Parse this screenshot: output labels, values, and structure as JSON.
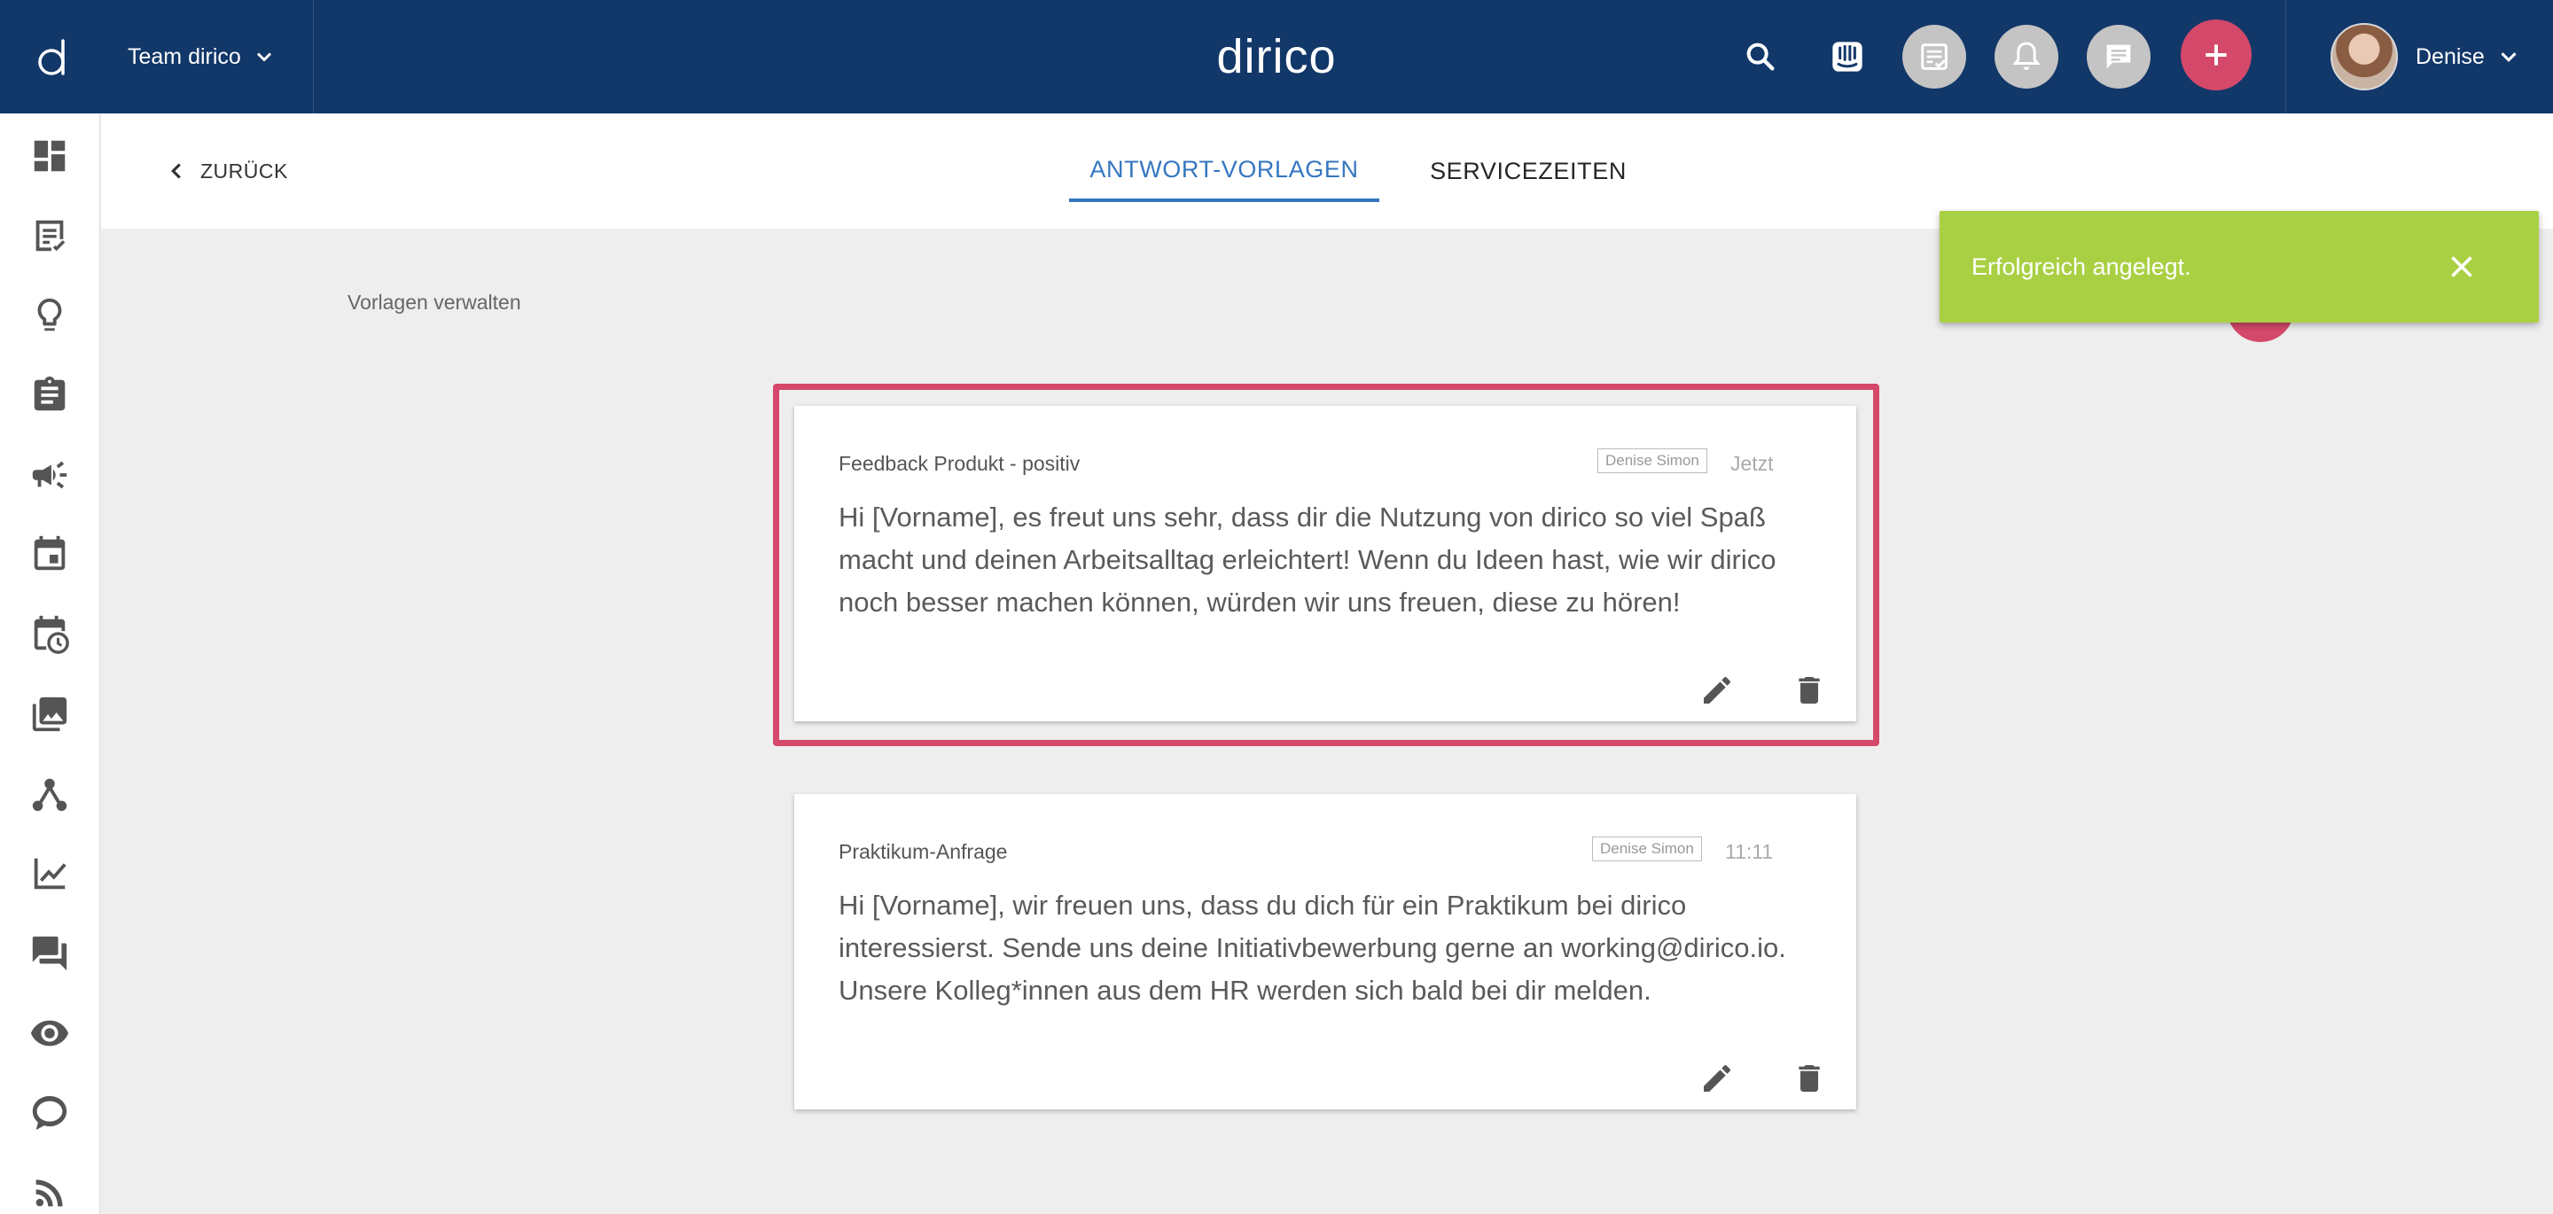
{
  "header": {
    "team_label": "Team dirico",
    "brand": "dirico",
    "user_name": "Denise",
    "colors": {
      "bar": "#123769",
      "accent": "#d4486a",
      "icon_bg": "#c4c4c4"
    },
    "icons": [
      "search-icon",
      "intercom-icon",
      "tasks-icon",
      "notifications-icon",
      "chat-icon",
      "add-icon"
    ]
  },
  "sidebar": {
    "items": [
      {
        "icon": "dashboard-icon"
      },
      {
        "icon": "checklist-icon"
      },
      {
        "icon": "lightbulb-icon"
      },
      {
        "icon": "clipboard-icon"
      },
      {
        "icon": "megaphone-icon"
      },
      {
        "icon": "calendar-icon"
      },
      {
        "icon": "calendar-clock-icon"
      },
      {
        "icon": "media-icon"
      },
      {
        "icon": "network-icon"
      },
      {
        "icon": "analytics-icon"
      },
      {
        "icon": "forum-icon"
      },
      {
        "icon": "eye-icon"
      },
      {
        "icon": "chat-bubble-icon"
      },
      {
        "icon": "rss-icon"
      }
    ]
  },
  "tabbar": {
    "back_label": "ZURÜCK",
    "tabs": [
      {
        "label": "ANTWORT-VORLAGEN",
        "active": true
      },
      {
        "label": "SERVICEZEITEN",
        "active": false
      }
    ]
  },
  "main": {
    "section_title": "Vorlagen verwalten",
    "templates": [
      {
        "title": "Feedback Produkt - positiv",
        "author": "Denise Simon",
        "time": "Jetzt",
        "body": "Hi [Vorname], es freut uns sehr, dass dir die Nutzung von dirico so viel Spaß macht und deinen Arbeitsalltag erleichtert! Wenn du Ideen hast, wie wir dirico noch besser machen können, würden wir uns freuen, diese zu hören!",
        "highlighted": true
      },
      {
        "title": "Praktikum-Anfrage",
        "author": "Denise Simon",
        "time": "11:11",
        "body": "Hi [Vorname], wir freuen uns, dass du dich für ein Praktikum bei dirico interessierst. Sende uns deine Initiativbewerbung gerne an working@dirico.io. Unsere Kolleg*innen aus dem HR werden sich bald bei dir melden.",
        "highlighted": false
      }
    ]
  },
  "toast": {
    "message": "Erfolgreich angelegt.",
    "color": "#a9d043"
  }
}
